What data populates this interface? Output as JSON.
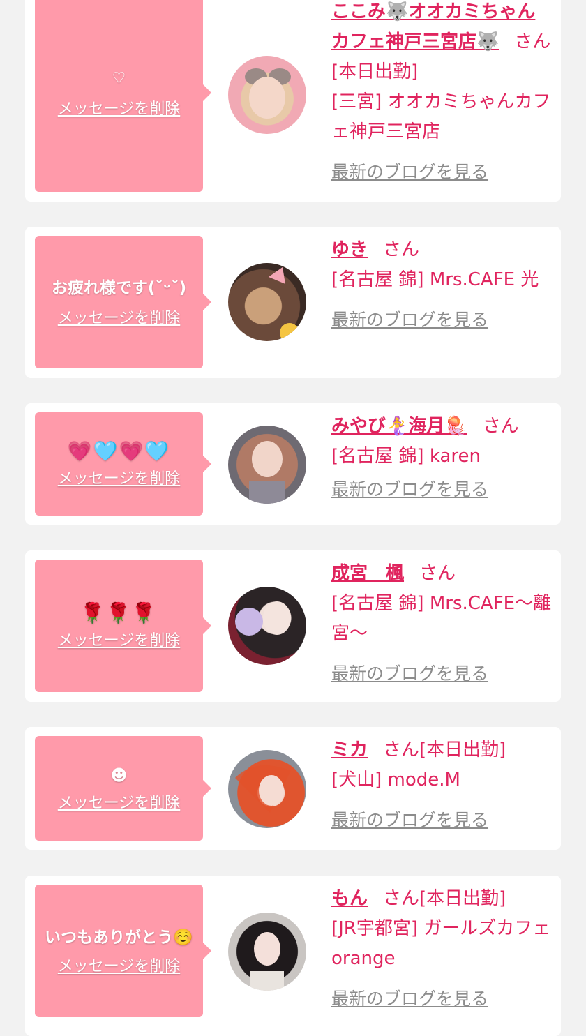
{
  "delete_label": "メッセージを削除",
  "blog_label": "最新のブログを見る",
  "san_label": "さん",
  "colors": {
    "bubble": "#ff9aaa",
    "accent": "#e0245e",
    "link_gray": "#8c8c8c",
    "background": "#f2f2f2"
  },
  "entries": [
    {
      "message": "♡",
      "name": "ここみ🐺オオカミちゃんカフェ神戸三宮店🐺",
      "status": "[本日出勤]",
      "shop": "[三宮] オオカミちゃんカフェ神戸三宮店",
      "avatar_icon": "user-avatar-photo"
    },
    {
      "message": "お疲れ様です(˘ᵕ˘)",
      "name": "ゆき",
      "status": "",
      "shop": "[名古屋 錦] Mrs.CAFE 光",
      "avatar_icon": "user-avatar-photo"
    },
    {
      "message": "💗🩵💗🩵",
      "name": "みやび🧜‍♀️海月🪼",
      "status": "",
      "shop": "[名古屋 錦] karen",
      "avatar_icon": "user-avatar-photo"
    },
    {
      "message": "🌹🌹🌹",
      "name": "成宮　楓",
      "status": "",
      "shop": "[名古屋 錦] Mrs.CAFE〜離宮〜",
      "avatar_icon": "user-avatar-photo"
    },
    {
      "message": "☻",
      "name": "ミカ",
      "status": "[本日出勤]",
      "shop": "[犬山] mode.M",
      "avatar_icon": "user-avatar-photo"
    },
    {
      "message": "いつもありがとう☺️",
      "name": "もん",
      "status": "[本日出勤]",
      "shop": "[JR宇都宮] ガールズカフェ orange",
      "avatar_icon": "user-avatar-photo"
    }
  ]
}
